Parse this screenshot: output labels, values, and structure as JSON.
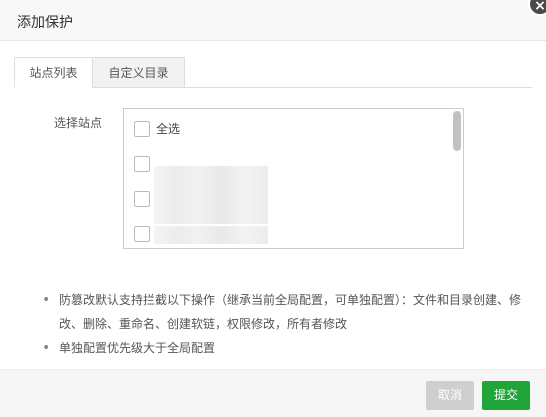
{
  "dialog": {
    "title": "添加保护",
    "close_icon": "close-icon",
    "tabs": [
      {
        "label": "站点列表",
        "active": true
      },
      {
        "label": "自定义目录",
        "active": false
      }
    ],
    "site_select": {
      "label": "选择站点",
      "select_all_label": "全选",
      "sites": [
        "",
        "",
        ""
      ]
    },
    "notes": [
      "防篡改默认支持拦截以下操作（继承当前全局配置，可单独配置）：文件和目录创建、修改、删除、重命名、创建软链，权限修改，所有者修改",
      "单独配置优先级大于全局配置"
    ],
    "footer": {
      "cancel_label": "取消",
      "submit_label": "提交"
    },
    "colors": {
      "submit": "#20a53a",
      "cancel": "#cfcfcf"
    }
  }
}
